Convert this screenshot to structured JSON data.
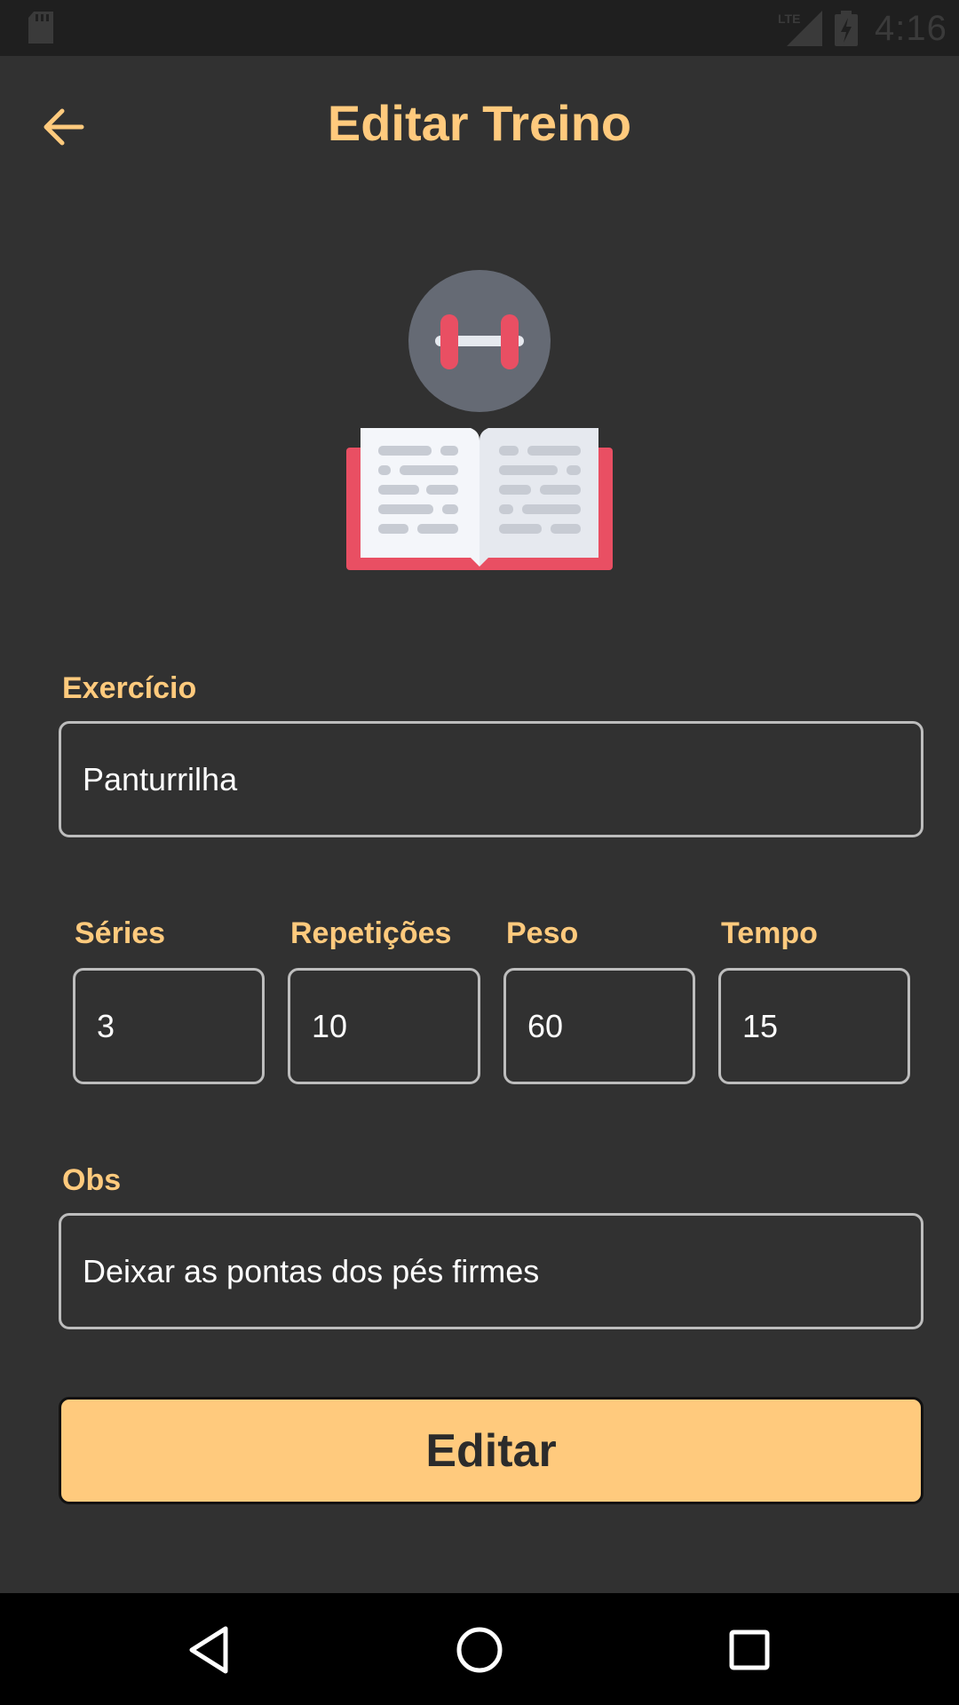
{
  "status_bar": {
    "time": "4:16",
    "network": "LTE",
    "icons": [
      "sd-card-icon",
      "signal-icon",
      "battery-charging-icon"
    ]
  },
  "header": {
    "title": "Editar Treino",
    "back_icon": "arrow-left-icon"
  },
  "hero": {
    "icon": "workout-book-icon"
  },
  "form": {
    "exercise": {
      "label": "Exercício",
      "value": "Panturrilha"
    },
    "series": {
      "label": "Séries",
      "value": "3"
    },
    "reps": {
      "label": "Repetições",
      "value": "10"
    },
    "weight": {
      "label": "Peso",
      "value": "60"
    },
    "time": {
      "label": "Tempo",
      "value": "15"
    },
    "notes": {
      "label": "Obs",
      "value": "Deixar as pontas dos pés firmes"
    }
  },
  "submit_label": "Editar",
  "nav": {
    "back": "nav-back-icon",
    "home": "nav-home-icon",
    "recents": "nav-recents-icon"
  },
  "colors": {
    "accent": "#FFCA7D",
    "background": "#313131",
    "border": "#BDBDBD"
  }
}
